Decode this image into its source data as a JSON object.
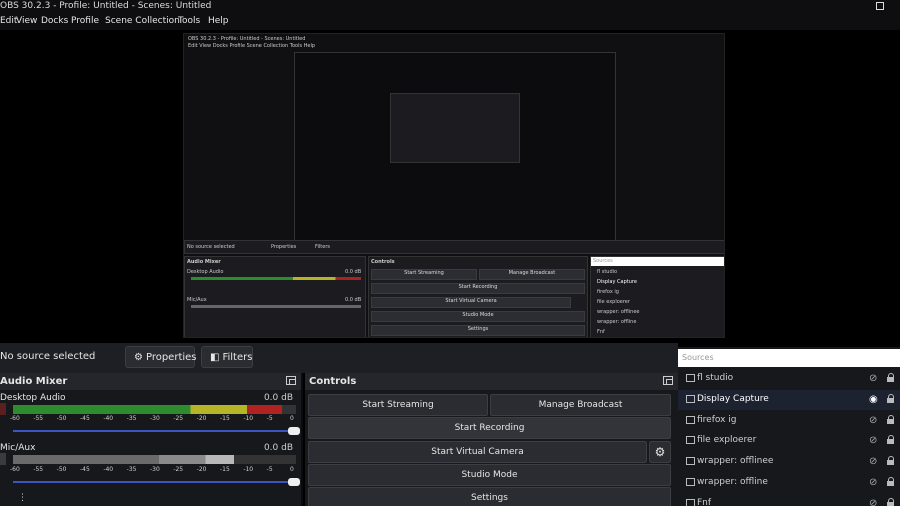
{
  "window": {
    "title": "OBS 30.2.3 - Profile: Untitled - Scenes: Untitled"
  },
  "menu": [
    "Edit",
    "View",
    "Docks",
    "Profile",
    "Scene Collection",
    "Tools",
    "Help"
  ],
  "nested_preview": {
    "title": "OBS 30.2.3 - Profile: Untitled - Scenes: Untitled",
    "menu": "Edit  View  Docks  Profile  Scene Collection  Tools  Help",
    "no_source": "No source selected",
    "properties": "Properties",
    "filters": "Filters",
    "mixer": "Audio Mixer",
    "desktop": "Desktop Audio",
    "mic": "Mic/Aux",
    "db": "0.0 dB",
    "controls": "Controls",
    "start_streaming": "Start Streaming",
    "manage_broadcast": "Manage Broadcast",
    "start_recording": "Start Recording",
    "start_virtual_camera": "Start Virtual Camera",
    "studio_mode": "Studio Mode",
    "settings": "Settings",
    "sources_placeholder": "Sources",
    "sources": [
      "fl studio",
      "Display Capture",
      "firefox ig",
      "file exploerer",
      "wrapper: offlinee",
      "wrapper: offline",
      "Fnf"
    ]
  },
  "source_bar": {
    "no_source": "No source selected",
    "properties": "Properties",
    "filters": "Filters"
  },
  "mixer": {
    "title": "Audio Mixer",
    "channels": [
      {
        "name": "Desktop Audio",
        "db": "0.0 dB",
        "level": 0.95
      },
      {
        "name": "Mic/Aux",
        "db": "0.0 dB",
        "level": 0.78
      }
    ],
    "ticks": [
      "-60",
      "-55",
      "-50",
      "-45",
      "-40",
      "-35",
      "-30",
      "-25",
      "-20",
      "-15",
      "-10",
      "-5",
      "0"
    ]
  },
  "controls": {
    "title": "Controls",
    "start_streaming": "Start Streaming",
    "manage_broadcast": "Manage Broadcast",
    "start_recording": "Start Recording",
    "start_virtual_camera": "Start Virtual Camera",
    "studio_mode": "Studio Mode",
    "settings": "Settings"
  },
  "sources": {
    "placeholder": "Sources",
    "items": [
      {
        "label": "fl studio",
        "visible": false
      },
      {
        "label": "Display Capture",
        "visible": true
      },
      {
        "label": "firefox ig",
        "visible": false
      },
      {
        "label": "file exploerer",
        "visible": false
      },
      {
        "label": "wrapper: offlinee",
        "visible": false
      },
      {
        "label": "wrapper: offline",
        "visible": false
      },
      {
        "label": "Fnf",
        "visible": false
      }
    ]
  },
  "colors": {
    "meter_green": "#2e8b2e",
    "meter_yellow": "#b5b526",
    "meter_red": "#b22222",
    "slider_blue": "#3b55c5"
  }
}
